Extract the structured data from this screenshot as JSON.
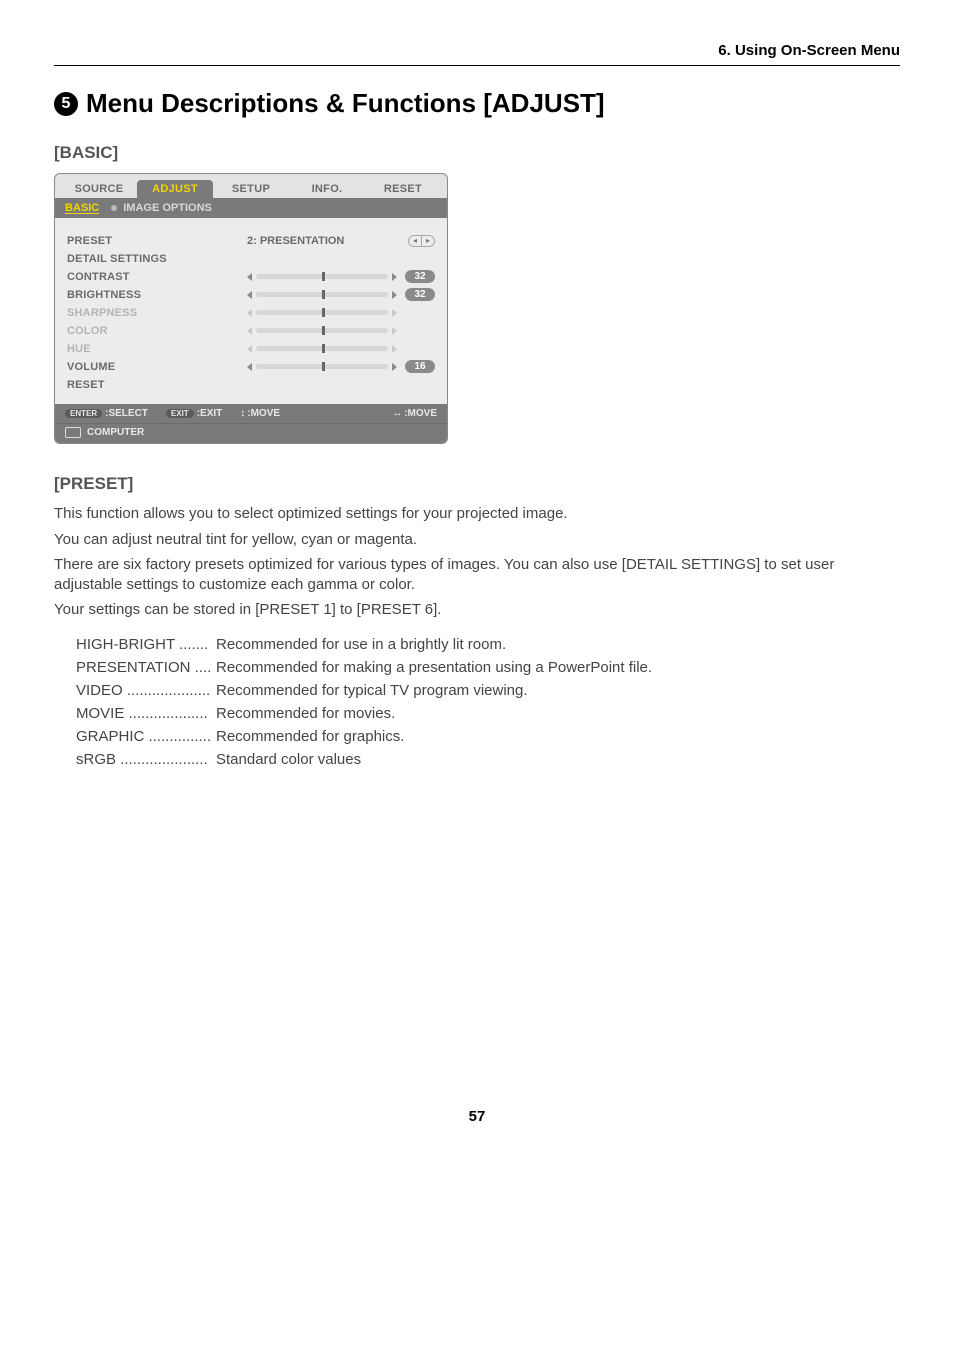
{
  "header": "6. Using On-Screen Menu",
  "section_number": "5",
  "section_title": "Menu Descriptions & Functions [ADJUST]",
  "basic_heading": "[BASIC]",
  "osd": {
    "tabs": [
      "SOURCE",
      "ADJUST",
      "SETUP",
      "INFO.",
      "RESET"
    ],
    "active_tab": 1,
    "subtabs": [
      {
        "label": "BASIC",
        "active": true
      },
      {
        "label": "IMAGE OPTIONS",
        "active": false
      }
    ],
    "rows": [
      {
        "label": "PRESET",
        "type": "select",
        "value": "2: PRESENTATION"
      },
      {
        "label": "DETAIL SETTINGS",
        "type": "link"
      },
      {
        "label": "CONTRAST",
        "type": "slider",
        "value": "32",
        "enabled": true
      },
      {
        "label": "BRIGHTNESS",
        "type": "slider",
        "value": "32",
        "enabled": true
      },
      {
        "label": "SHARPNESS",
        "type": "slider",
        "value": "",
        "enabled": false
      },
      {
        "label": "COLOR",
        "type": "slider",
        "value": "",
        "enabled": false
      },
      {
        "label": "HUE",
        "type": "slider",
        "value": "",
        "enabled": false
      },
      {
        "label": "VOLUME",
        "type": "slider",
        "value": "16",
        "enabled": true
      },
      {
        "label": "RESET",
        "type": "link"
      }
    ],
    "hints": {
      "enter": "ENTER",
      "select": ":SELECT",
      "exit_btn": "EXIT",
      "exit": ":EXIT",
      "move_ud": ":MOVE",
      "move_lr": ":MOVE"
    },
    "source": "COMPUTER"
  },
  "preset_heading": "[PRESET]",
  "preset_paras": [
    "This function allows you to select optimized settings for your projected image.",
    "You can adjust neutral tint for yellow, cyan or magenta.",
    "There are six factory presets optimized for various types of images. You can also use [DETAIL SETTINGS] to set user adjustable settings to customize each gamma or color.",
    "Your settings can be stored in [PRESET 1] to [PRESET 6]."
  ],
  "preset_items": [
    {
      "name": "HIGH-BRIGHT ....... ",
      "desc": "Recommended for use in a brightly lit room."
    },
    {
      "name": "PRESENTATION .... ",
      "desc": "Recommended for making a presentation using a PowerPoint file."
    },
    {
      "name": "VIDEO .................... ",
      "desc": "Recommended for typical TV program viewing."
    },
    {
      "name": "MOVIE ................... ",
      "desc": "Recommended for movies."
    },
    {
      "name": "GRAPHIC ............... ",
      "desc": "Recommended for graphics."
    },
    {
      "name": "sRGB ..................... ",
      "desc": "Standard color values"
    }
  ],
  "page_number": "57"
}
